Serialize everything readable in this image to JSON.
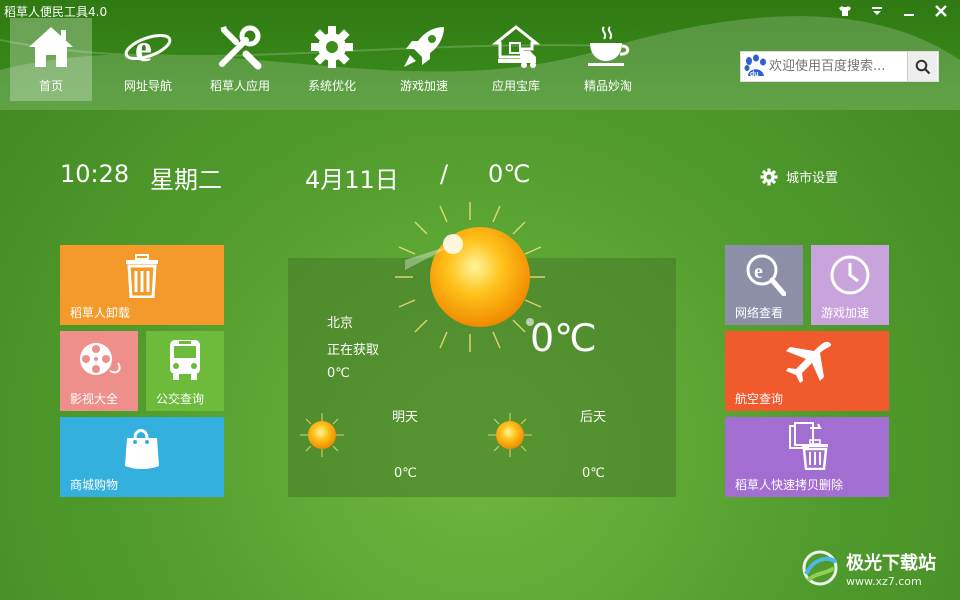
{
  "window": {
    "title": "稻草人便民工具4.0"
  },
  "nav": [
    {
      "label": "首页",
      "icon": "home-icon"
    },
    {
      "label": "网址导航",
      "icon": "ie-browser-icon"
    },
    {
      "label": "稻草人应用",
      "icon": "tools-icon"
    },
    {
      "label": "系统优化",
      "icon": "gear-icon"
    },
    {
      "label": "游戏加速",
      "icon": "rocket-icon"
    },
    {
      "label": "应用宝库",
      "icon": "house-truck-icon"
    },
    {
      "label": "精品妙淘",
      "icon": "coffee-cup-icon"
    }
  ],
  "search": {
    "placeholder": "欢迎使用百度搜索..."
  },
  "info": {
    "time": "10:28",
    "weekday": "星期二",
    "date": "4月11日",
    "separator": "/",
    "temp": "0℃"
  },
  "city_setting": {
    "label": "城市设置"
  },
  "tiles_left": [
    {
      "label": "稻草人卸载",
      "color": "#f39a2a"
    },
    {
      "label": "影视大全",
      "color": "#ef8f8c"
    },
    {
      "label": "公交查询",
      "color": "#6dbb3a"
    },
    {
      "label": "商城购物",
      "color": "#34b0de"
    }
  ],
  "tiles_right": [
    {
      "label": "网络查看",
      "color": "#8d8fa8"
    },
    {
      "label": "游戏加速",
      "color": "#c9a3dc"
    },
    {
      "label": "航空查询",
      "color": "#f15a2c"
    },
    {
      "label": "稻草人快速拷贝删除",
      "color": "#a36ed1"
    }
  ],
  "weather": {
    "city": "北京",
    "status": "正在获取",
    "temp_small": "0℃",
    "temp_big": "0℃",
    "tomorrow": {
      "label": "明天",
      "temp": "0℃"
    },
    "after": {
      "label": "后天",
      "temp": "0℃"
    }
  },
  "watermark": {
    "text": "极光下载站",
    "url": "www.xz7.com"
  }
}
